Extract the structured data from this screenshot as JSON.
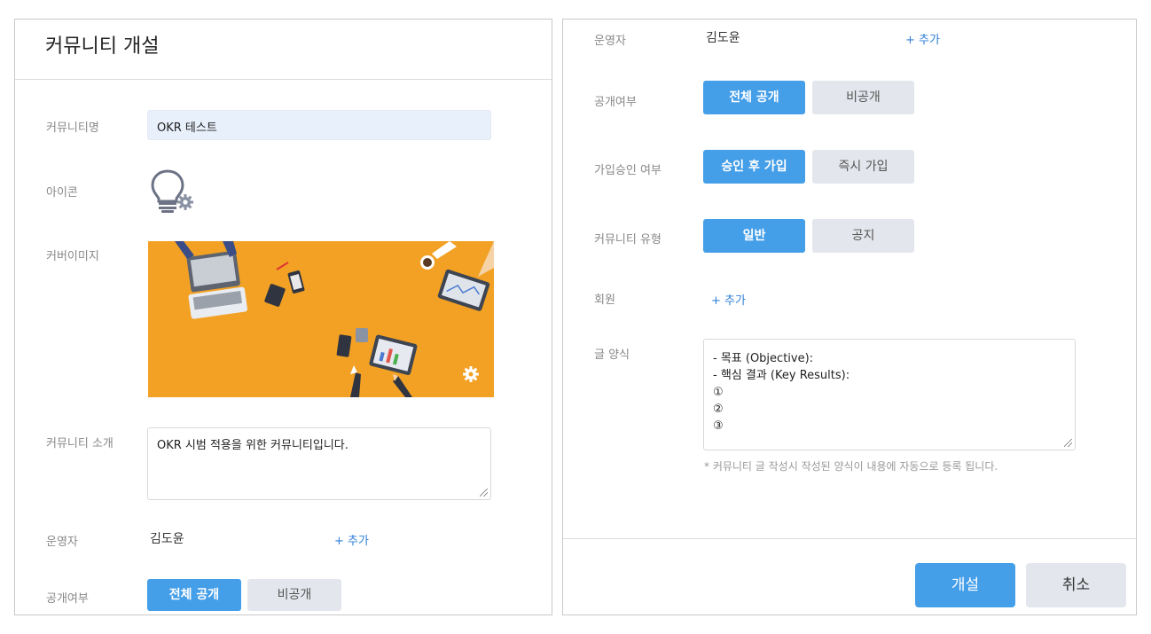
{
  "left": {
    "title": "커뮤니티 개설",
    "name_label": "커뮤니티명",
    "name_value": "OKR 테스트",
    "icon_label": "아이콘",
    "cover_label": "커버이미지",
    "intro_label": "커뮤니티 소개",
    "intro_value": "OKR 시범 적용을 위한 커뮤니티입니다.",
    "operator_label": "운영자",
    "operator_value": "김도윤",
    "operator_add": "+ 추가",
    "public_label": "공개여부",
    "public_options": [
      "전체 공개",
      "비공개"
    ]
  },
  "right": {
    "operator_label": "운영자",
    "operator_value": "김도윤",
    "operator_add": "+ 추가",
    "public_label": "공개여부",
    "public_options": [
      "전체 공개",
      "비공개"
    ],
    "approval_label": "가입승인 여부",
    "approval_options": [
      "승인 후 가입",
      "즉시 가입"
    ],
    "type_label": "커뮤니티 유형",
    "type_options": [
      "일반",
      "공지"
    ],
    "member_label": "회원",
    "member_add": "+ 추가",
    "template_label": "글 양식",
    "template_lines": [
      "- 목표 (Objective):",
      "- 핵심 결과 (Key Results):",
      "①",
      "②",
      "③"
    ],
    "template_note": "* 커뮤니티 글 작성시 작성된 양식이 내용에 자동으로 등록 됩니다.",
    "create_button": "개설",
    "cancel_button": "취소"
  },
  "colors": {
    "accent": "#449ee8",
    "cover_bg": "#f2a124",
    "inactive_button": "#e3e6ec",
    "link": "#2f7fd8"
  },
  "icons": [
    "lightbulb-icon",
    "gear-icon",
    "cover-gear-icon",
    "resize-grip-icon"
  ]
}
